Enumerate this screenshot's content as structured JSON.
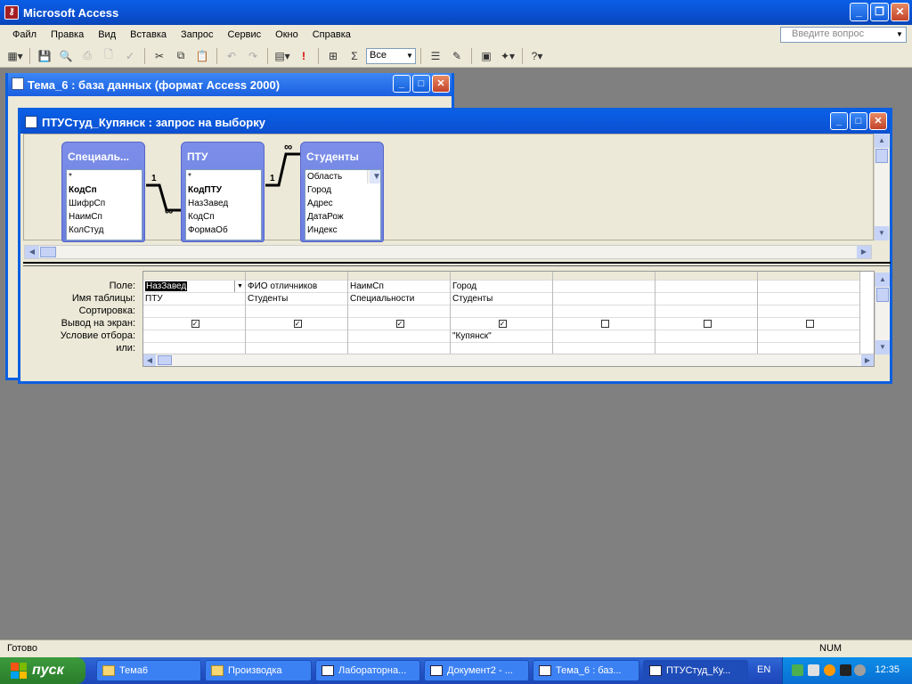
{
  "app": {
    "title": "Microsoft Access"
  },
  "menu": [
    "Файл",
    "Правка",
    "Вид",
    "Вставка",
    "Запрос",
    "Сервис",
    "Окно",
    "Справка"
  ],
  "help": {
    "placeholder": "Введите вопрос"
  },
  "toolbar": {
    "top_values": "Все"
  },
  "db_window": {
    "title": "Тема_6 : база данных (формат Access 2000)"
  },
  "query_window": {
    "title": "ПТУСтуд_Купянск : запрос на выборку"
  },
  "tables": [
    {
      "name": "Специаль...",
      "fields": [
        "*",
        "КодСп",
        "ШифрСп",
        "НаимСп",
        "КолСтуд"
      ],
      "bold": [
        1
      ]
    },
    {
      "name": "ПТУ",
      "fields": [
        "*",
        "КодПТУ",
        "НазЗавед",
        "КодСп",
        "ФормаОб"
      ],
      "bold": [
        1
      ]
    },
    {
      "name": "Студенты",
      "fields": [
        "Область",
        "Город",
        "Адрес",
        "ДатаРож",
        "Индекс"
      ],
      "bold": []
    }
  ],
  "relations": [
    {
      "one": "1",
      "many": "∞"
    },
    {
      "one": "1",
      "many": "∞"
    }
  ],
  "grid": {
    "row_labels": [
      "Поле:",
      "Имя таблицы:",
      "Сортировка:",
      "Вывод на экран:",
      "Условие отбора:",
      "или:"
    ],
    "columns": [
      {
        "field": "НазЗавед",
        "table": "ПТУ",
        "sort": "",
        "show": true,
        "criteria": "",
        "or": ""
      },
      {
        "field": "ФИО отличников",
        "table": "Студенты",
        "sort": "",
        "show": true,
        "criteria": "",
        "or": ""
      },
      {
        "field": "НаимСп",
        "table": "Специальности",
        "sort": "",
        "show": true,
        "criteria": "",
        "or": ""
      },
      {
        "field": "Город",
        "table": "Студенты",
        "sort": "",
        "show": true,
        "criteria": "\"Купянск\"",
        "or": ""
      },
      {
        "field": "",
        "table": "",
        "sort": "",
        "show": false,
        "criteria": "",
        "or": ""
      },
      {
        "field": "",
        "table": "",
        "sort": "",
        "show": false,
        "criteria": "",
        "or": ""
      },
      {
        "field": "",
        "table": "",
        "sort": "",
        "show": false,
        "criteria": "",
        "or": ""
      }
    ]
  },
  "status": {
    "left": "Готово",
    "num": "NUM"
  },
  "taskbar": {
    "start": "пуск",
    "tasks": [
      "Тема6",
      "Производка",
      "Лабораторна...",
      "Документ2 - ...",
      "Тема_6 : баз...",
      "ПТУСтуд_Ку..."
    ],
    "lang": "EN",
    "clock": "12:35"
  }
}
